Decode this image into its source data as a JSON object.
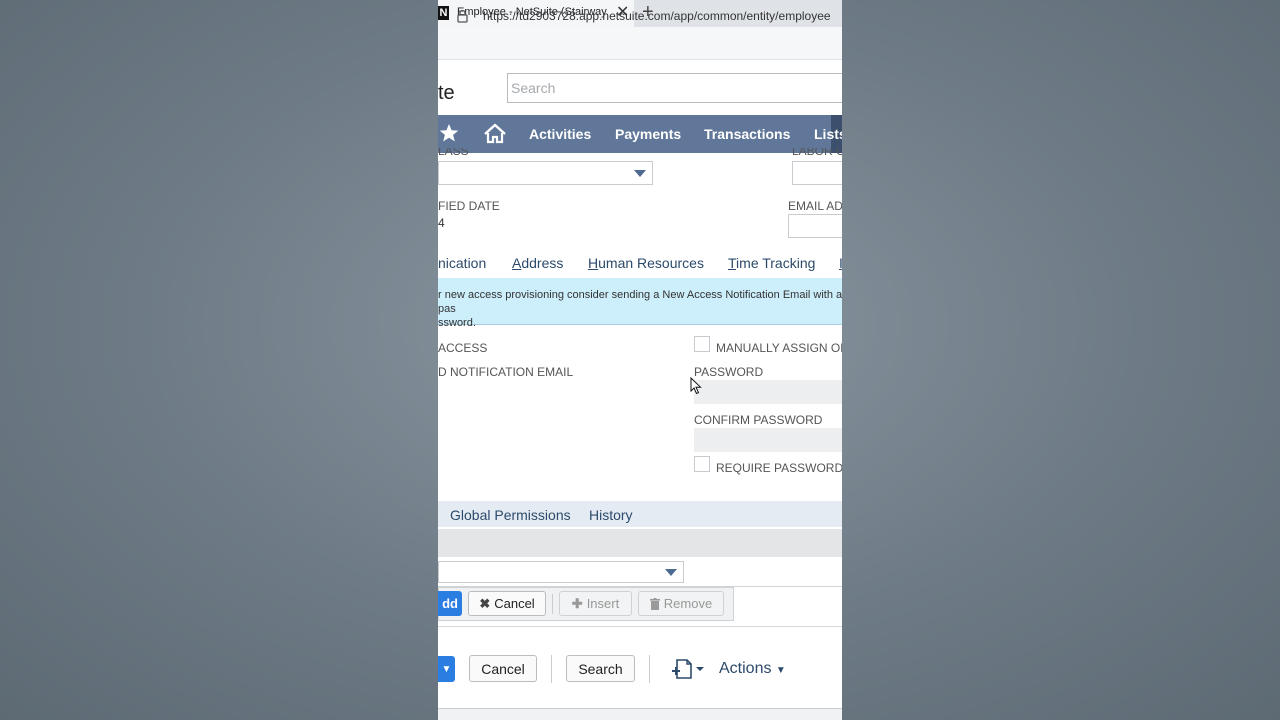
{
  "browser": {
    "favicon_letter": "N",
    "tab_title": "Employee - NetSuite (Stairway fo",
    "close_glyph": "✕",
    "newtab_glyph": "+",
    "url": "https://td2903728.app.netsuite.com/app/common/entity/employee"
  },
  "header": {
    "logo_text": "te",
    "search_placeholder": "Search"
  },
  "nav": {
    "items": [
      "Activities",
      "Payments",
      "Transactions",
      "Lists"
    ]
  },
  "fields": {
    "class_label": "LASS",
    "labor_label": "LABOR CO",
    "modified_label": "FIED DATE",
    "modified_value": "4",
    "email_label": "EMAIL ADD"
  },
  "subtabs": {
    "communication": "nication",
    "address_first": "A",
    "address_rest": "ddress",
    "hr_first": "H",
    "hr_rest": "uman Resources",
    "time_first": "T",
    "time_rest": "ime Tracking",
    "more": "I"
  },
  "notice": {
    "line1": "r new access provisioning consider sending a New Access Notification Email with a pas",
    "line2": "ssword."
  },
  "access": {
    "access_label": "ACCESS",
    "notification_label": "D NOTIFICATION EMAIL",
    "manual_label": "MANUALLY ASSIGN OR",
    "password_label": "PASSWORD",
    "confirm_label": "CONFIRM PASSWORD",
    "require_label": "REQUIRE PASSWORD CH"
  },
  "permissions": {
    "tabs": [
      "Global Permissions",
      "History"
    ]
  },
  "line_buttons": {
    "add": "dd",
    "cancel": "Cancel",
    "insert": "Insert",
    "remove": "Remove"
  },
  "bottom_buttons": {
    "cancel": "Cancel",
    "search": "Search",
    "actions": "Actions"
  },
  "colors": {
    "nav_bg": "#607799",
    "accent_blue": "#2a7de1",
    "notice_bg": "#cdeefb",
    "link_text": "#2c4a6b"
  }
}
